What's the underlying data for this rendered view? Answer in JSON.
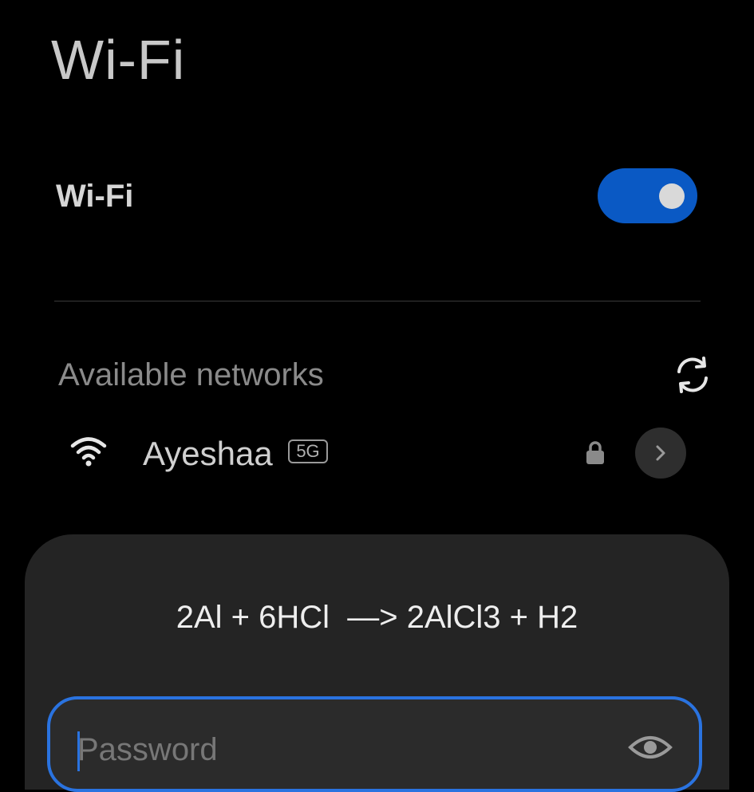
{
  "header": {
    "title": "Wi-Fi"
  },
  "wifi_toggle": {
    "label": "Wi-Fi",
    "state": "on",
    "accent_color": "#0a59c4"
  },
  "available_networks": {
    "title": "Available networks",
    "refresh_icon": "refresh-icon",
    "items": [
      {
        "name": "Ayeshaa",
        "band": "5G",
        "signal_icon": "wifi-signal-icon",
        "secured": true,
        "lock_icon": "lock-icon",
        "details_icon": "chevron-right-icon"
      }
    ]
  },
  "dialog": {
    "title": "2Al + 6HCl  —> 2AlCl3 + H2",
    "password_field": {
      "placeholder": "Password",
      "value": "",
      "toggle_icon": "eye-icon",
      "focus_color": "#2a73e0"
    }
  }
}
